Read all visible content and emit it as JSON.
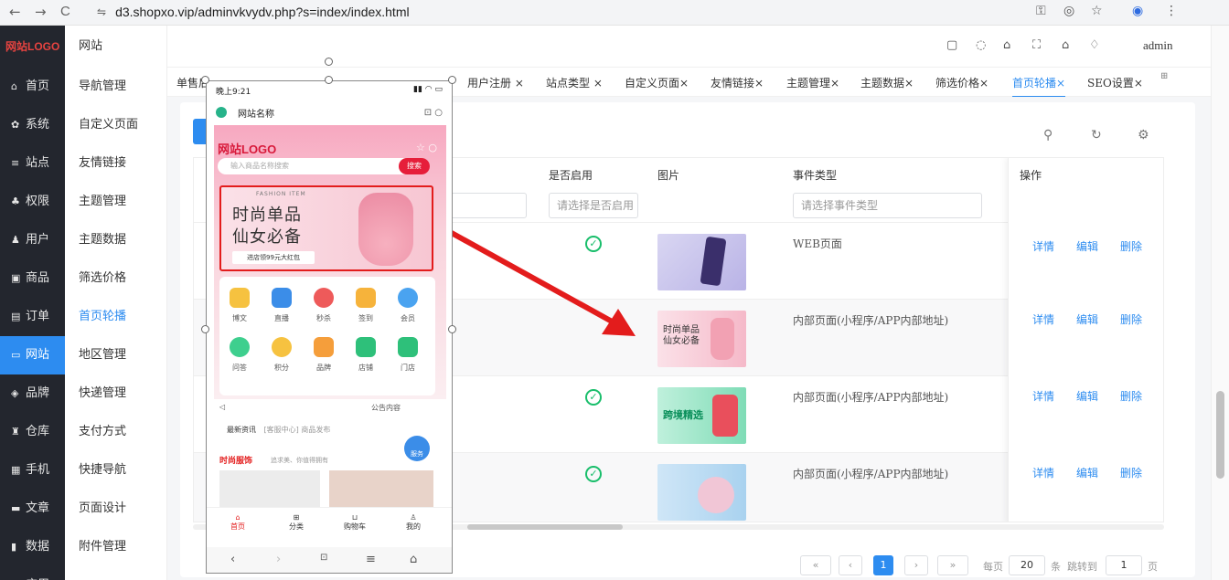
{
  "browser": {
    "url": "d3.shopxo.vip/adminvkvydv.php?s=index/index.html",
    "nav": {
      "back": "←",
      "forward": "→",
      "reload": "C"
    }
  },
  "left_menu": {
    "logo": "网站LOGO",
    "items": [
      {
        "icon": "home-icon",
        "label": "首页",
        "active": false
      },
      {
        "icon": "gear-icon",
        "label": "系统",
        "active": false
      },
      {
        "icon": "sliders-icon",
        "label": "站点",
        "active": false
      },
      {
        "icon": "user-group-icon",
        "label": "权限",
        "active": false
      },
      {
        "icon": "user-icon",
        "label": "用户",
        "active": false
      },
      {
        "icon": "image-icon",
        "label": "商品",
        "active": false
      },
      {
        "icon": "doc-icon",
        "label": "订单",
        "active": false
      },
      {
        "icon": "monitor-icon",
        "label": "网站",
        "active": true
      },
      {
        "icon": "brand-icon",
        "label": "品牌",
        "active": false
      },
      {
        "icon": "warehouse-icon",
        "label": "仓库",
        "active": false
      },
      {
        "icon": "phone-icon",
        "label": "手机",
        "active": false
      },
      {
        "icon": "article-icon",
        "label": "文章",
        "active": false
      },
      {
        "icon": "chart-icon",
        "label": "数据",
        "active": false
      },
      {
        "icon": "apps-icon",
        "label": "应用",
        "active": false
      }
    ]
  },
  "sub_menu": {
    "title": "网站",
    "items": [
      {
        "label": "导航管理",
        "active": false
      },
      {
        "label": "自定义页面",
        "active": false
      },
      {
        "label": "友情链接",
        "active": false
      },
      {
        "label": "主题管理",
        "active": false
      },
      {
        "label": "主题数据",
        "active": false
      },
      {
        "label": "筛选价格",
        "active": false
      },
      {
        "label": "首页轮播",
        "active": true
      },
      {
        "label": "地区管理",
        "active": false
      },
      {
        "label": "快递管理",
        "active": false
      },
      {
        "label": "支付方式",
        "active": false
      },
      {
        "label": "快捷导航",
        "active": false
      },
      {
        "label": "页面设计",
        "active": false
      },
      {
        "label": "附件管理",
        "active": false
      }
    ]
  },
  "header": {
    "user": "admin"
  },
  "tabs": [
    {
      "label": "单售后",
      "active": false
    },
    {
      "label": "用户注册 ×",
      "active": false
    },
    {
      "label": "站点类型 ×",
      "active": false
    },
    {
      "label": "自定义页面×",
      "active": false
    },
    {
      "label": "友情链接×",
      "active": false
    },
    {
      "label": "主题管理×",
      "active": false
    },
    {
      "label": "主题数据×",
      "active": false
    },
    {
      "label": "筛选价格×",
      "active": false
    },
    {
      "label": "首页轮播×",
      "active": true
    },
    {
      "label": "SEO设置×",
      "active": false
    }
  ],
  "table": {
    "columns": {
      "enabled": "是否启用",
      "image": "图片",
      "event_type": "事件类型",
      "actions": "操作"
    },
    "filters": {
      "enabled_placeholder": "请选择是否启用",
      "event_placeholder": "请选择事件类型"
    },
    "rows": [
      {
        "enabled": true,
        "event_type": "WEB页面"
      },
      {
        "enabled": true,
        "event_type": "内部页面(小程序/APP内部地址)"
      },
      {
        "enabled": true,
        "event_type": "内部页面(小程序/APP内部地址)"
      },
      {
        "enabled": true,
        "event_type": "内部页面(小程序/APP内部地址)"
      }
    ],
    "row_actions": {
      "detail": "详情",
      "edit": "编辑",
      "delete": "删除"
    }
  },
  "pagination": {
    "first": "«",
    "prev": "‹",
    "current": "1",
    "next": "›",
    "last": "»",
    "per_page_label": "每页",
    "per_page": "20",
    "unit": "条",
    "jump_label": "跳转到",
    "jump_page": "1",
    "page_label": "页"
  },
  "phone": {
    "status_time": "晚上9:21",
    "site_name": "网站名称",
    "logo": "网站LOGO",
    "search_placeholder": "输入商品名称搜索",
    "search_button": "搜索",
    "banner_small": "FASHION ITEM",
    "banner_line1": "时尚单品",
    "banner_line2": "仙女必备",
    "banner_coupon": "进店领99元大红包",
    "grid": [
      "博文",
      "直播",
      "秒杀",
      "签到",
      "会员",
      "问答",
      "积分",
      "品牌",
      "店铺",
      "门店"
    ],
    "notice": "公告内容",
    "news_tag": "最新资讯",
    "news_text": "[客服中心] 商品发布",
    "section_title": "时尚服饰",
    "section_sub": "追求美、你值得拥有",
    "tabbar": [
      "首页",
      "分类",
      "购物车",
      "我的"
    ],
    "float_label": "服务"
  },
  "colors": {
    "accent": "#2d8cf0",
    "menu_bg": "#23262e",
    "arrow": "#e31c1c",
    "success": "#19be6b"
  }
}
